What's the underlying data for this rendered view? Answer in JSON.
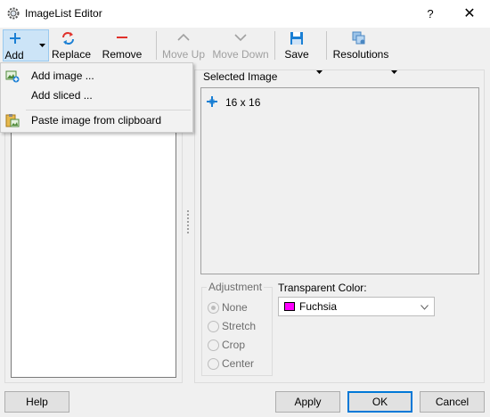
{
  "window": {
    "title": "ImageList Editor",
    "help_glyph": "?",
    "close_glyph": "✕"
  },
  "toolbar": {
    "add": "Add",
    "replace": "Replace",
    "remove": "Remove",
    "move_up": "Move Up",
    "move_down": "Move Down",
    "save": "Save",
    "resolutions": "Resolutions"
  },
  "add_menu": {
    "items": [
      {
        "label": "Add image ...",
        "icon": "add-image-icon"
      },
      {
        "label": "Add sliced ...",
        "icon": ""
      },
      {
        "label": "Paste image from clipboard",
        "icon": "paste-icon"
      }
    ]
  },
  "selected_image": {
    "legend": "Selected Image",
    "size_label": "16 x 16"
  },
  "adjustment": {
    "legend": "Adjustment",
    "options": [
      "None",
      "Stretch",
      "Crop",
      "Center"
    ],
    "selected": "None",
    "enabled": false
  },
  "transparent_color": {
    "label": "Transparent Color:",
    "value": "Fuchsia",
    "swatch_color": "#ff00ff"
  },
  "buttons": {
    "help": "Help",
    "apply": "Apply",
    "ok": "OK",
    "cancel": "Cancel"
  },
  "colors": {
    "accent": "#0078d7",
    "add_icon": "#1a7fd4",
    "replace_icon_red": "#e0302a",
    "replace_icon_blue": "#1a7fd4",
    "remove_icon": "#e0302a",
    "save_icon": "#1a7fd4"
  }
}
